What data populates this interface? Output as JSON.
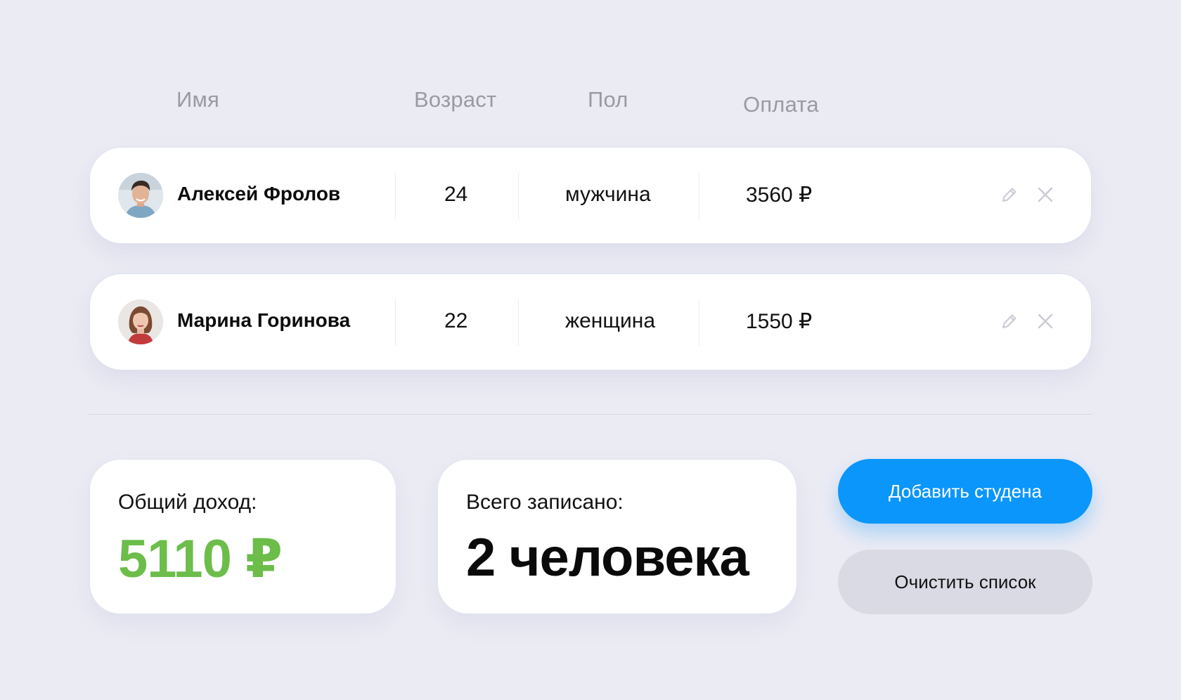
{
  "headers": {
    "name": "Имя",
    "age": "Возраст",
    "sex": "Пол",
    "payment": "Оплата"
  },
  "students": [
    {
      "name": "Алексей Фролов",
      "age": "24",
      "sex": "мужчина",
      "payment": "3560 ₽",
      "avatar": "male-avatar"
    },
    {
      "name": "Марина Горинова",
      "age": "22",
      "sex": "женщина",
      "payment": "1550 ₽",
      "avatar": "female-avatar"
    }
  ],
  "row_actions": {
    "edit_icon": "pencil-icon",
    "delete_icon": "close-icon"
  },
  "stats": {
    "income_label": "Общий доход:",
    "income_value": "5110 ₽",
    "count_label": "Всего записано:",
    "count_value": "2 человека"
  },
  "buttons": {
    "add": "Добавить студена",
    "clear": "Очистить список"
  },
  "colors": {
    "background": "#ebebf4",
    "accent": "#0a96fb",
    "income": "#6cbd4a",
    "secondary_button": "#dadae5"
  }
}
